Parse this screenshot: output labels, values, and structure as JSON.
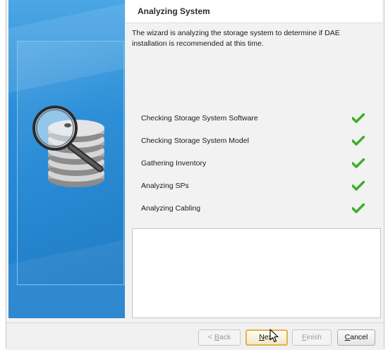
{
  "header": {
    "title": "Analyzing System"
  },
  "description": "The wizard is analyzing the storage system to determine if DAE installation is recommended at this time.",
  "checks": [
    {
      "label": "Checking Storage System Software",
      "status": "done"
    },
    {
      "label": "Checking Storage System Model",
      "status": "done"
    },
    {
      "label": "Gathering Inventory",
      "status": "done"
    },
    {
      "label": "Analyzing SPs",
      "status": "done"
    },
    {
      "label": "Analyzing Cabling",
      "status": "done"
    }
  ],
  "log": {
    "text": ""
  },
  "buttons": {
    "back": {
      "prefix": "< ",
      "hotkey": "B",
      "rest": "ack",
      "enabled": false
    },
    "next": {
      "prefix": "",
      "hotkey": "N",
      "rest": "ext",
      "enabled": true
    },
    "finish": {
      "prefix": "",
      "hotkey": "F",
      "rest": "inish",
      "enabled": false
    },
    "cancel": {
      "prefix": "",
      "hotkey": "C",
      "rest": "ancel",
      "enabled": true
    }
  },
  "colors": {
    "accent_blue": "#2a8ed8",
    "check_green": "#3fae2a",
    "focus_border": "#e0b444"
  },
  "icons": {
    "wizard_graphic": "magnifier-over-disk-stack-icon",
    "check": "green-checkmark-icon",
    "cursor": "mouse-pointer-icon"
  }
}
